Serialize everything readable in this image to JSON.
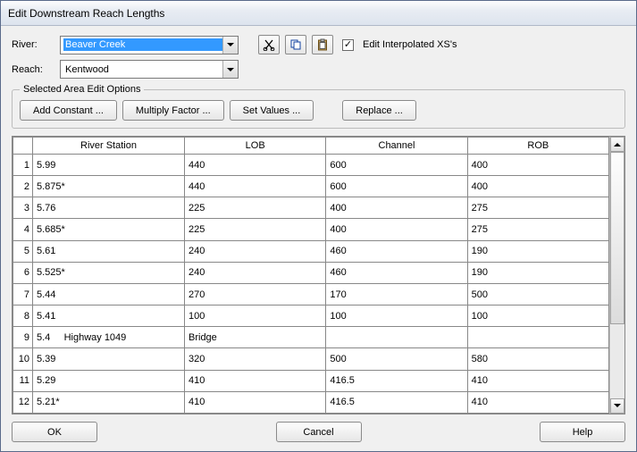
{
  "window": {
    "title": "Edit Downstream Reach Lengths"
  },
  "river": {
    "label": "River:",
    "value": "Beaver Creek"
  },
  "reach": {
    "label": "Reach:",
    "value": "Kentwood"
  },
  "checkbox": {
    "label": "Edit Interpolated XS's",
    "checked": true
  },
  "group": {
    "legend": "Selected Area Edit Options",
    "buttons": {
      "add": "Add Constant ...",
      "mult": "Multiply Factor ...",
      "set": "Set Values ...",
      "replace": "Replace ..."
    }
  },
  "table": {
    "headers": [
      "River Station",
      "LOB",
      "Channel",
      "ROB"
    ],
    "rows": [
      {
        "n": "1",
        "station": "5.99",
        "lob": "440",
        "channel": "600",
        "rob": "400"
      },
      {
        "n": "2",
        "station": "5.875*",
        "lob": "440",
        "channel": "600",
        "rob": "400"
      },
      {
        "n": "3",
        "station": "5.76",
        "lob": "225",
        "channel": "400",
        "rob": "275"
      },
      {
        "n": "4",
        "station": "5.685*",
        "lob": "225",
        "channel": "400",
        "rob": "275"
      },
      {
        "n": "5",
        "station": "5.61",
        "lob": "240",
        "channel": "460",
        "rob": "190"
      },
      {
        "n": "6",
        "station": "5.525*",
        "lob": "240",
        "channel": "460",
        "rob": "190"
      },
      {
        "n": "7",
        "station": "5.44",
        "lob": "270",
        "channel": "170",
        "rob": "500"
      },
      {
        "n": "8",
        "station": "5.41",
        "lob": "100",
        "channel": "100",
        "rob": "100"
      },
      {
        "n": "9",
        "station": "5.4     Highway 1049",
        "lob": "Bridge",
        "channel": "",
        "rob": ""
      },
      {
        "n": "10",
        "station": "5.39",
        "lob": "320",
        "channel": "500",
        "rob": "580"
      },
      {
        "n": "11",
        "station": "5.29",
        "lob": "410",
        "channel": "416.5",
        "rob": "410"
      },
      {
        "n": "12",
        "station": "5.21*",
        "lob": "410",
        "channel": "416.5",
        "rob": "410"
      }
    ]
  },
  "footer": {
    "ok": "OK",
    "cancel": "Cancel",
    "help": "Help"
  }
}
